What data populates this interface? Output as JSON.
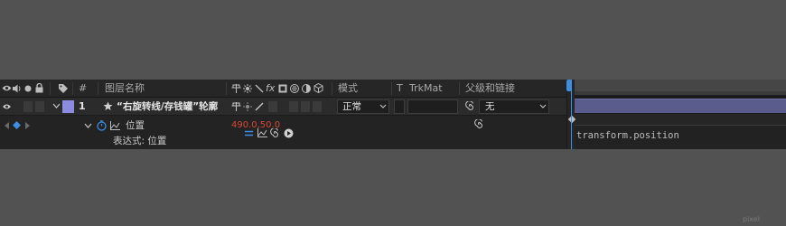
{
  "header": {
    "layer_name_col": "图层名称",
    "number_col": "#",
    "mode_col": "模式",
    "t_col": "T",
    "trkmat_col": "TrkMat",
    "parent_col": "父级和链接",
    "switch_icons": [
      "shy-icon",
      "collapse-icon",
      "quality-icon",
      "fx-icon",
      "frame-blend-icon",
      "motion-blur-icon",
      "adjustment-icon",
      "3d-icon"
    ]
  },
  "layer": {
    "index": "1",
    "name": "“右旋转线/存钱罐”轮廓",
    "mode": "正常",
    "parent": "无",
    "label_color": "#8b8bdf"
  },
  "property": {
    "name": "位置",
    "value": "490.0,50.0",
    "value_color": "#d94a35"
  },
  "expression": {
    "label": "表达式: 位置",
    "text": "transform.position"
  },
  "colors": {
    "cti": "#3d8ee0",
    "layer_bar": "#5a5c8e"
  },
  "watermark": "pixel"
}
